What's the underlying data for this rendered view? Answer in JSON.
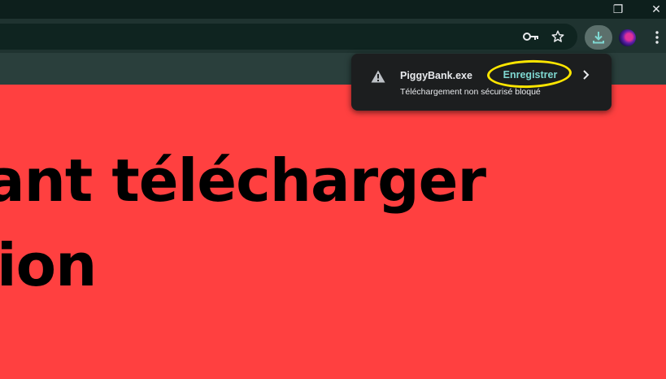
{
  "window_controls": {
    "restore_glyph": "❐",
    "close_glyph": "✕"
  },
  "toolbar": {
    "icons": [
      "key-icon",
      "star-icon",
      "download-icon",
      "profile-avatar",
      "more-menu-icon"
    ]
  },
  "page": {
    "headline_line1": "ant télécharger",
    "headline_line2": "ion",
    "background_color": "#ff4040"
  },
  "download_popup": {
    "filename": "PiggyBank.exe",
    "action_label": "Enregistrer",
    "status": "Téléchargement non sécurisé bloqué",
    "accent_color": "#7fd8d2",
    "highlight_color": "#ffe600"
  }
}
